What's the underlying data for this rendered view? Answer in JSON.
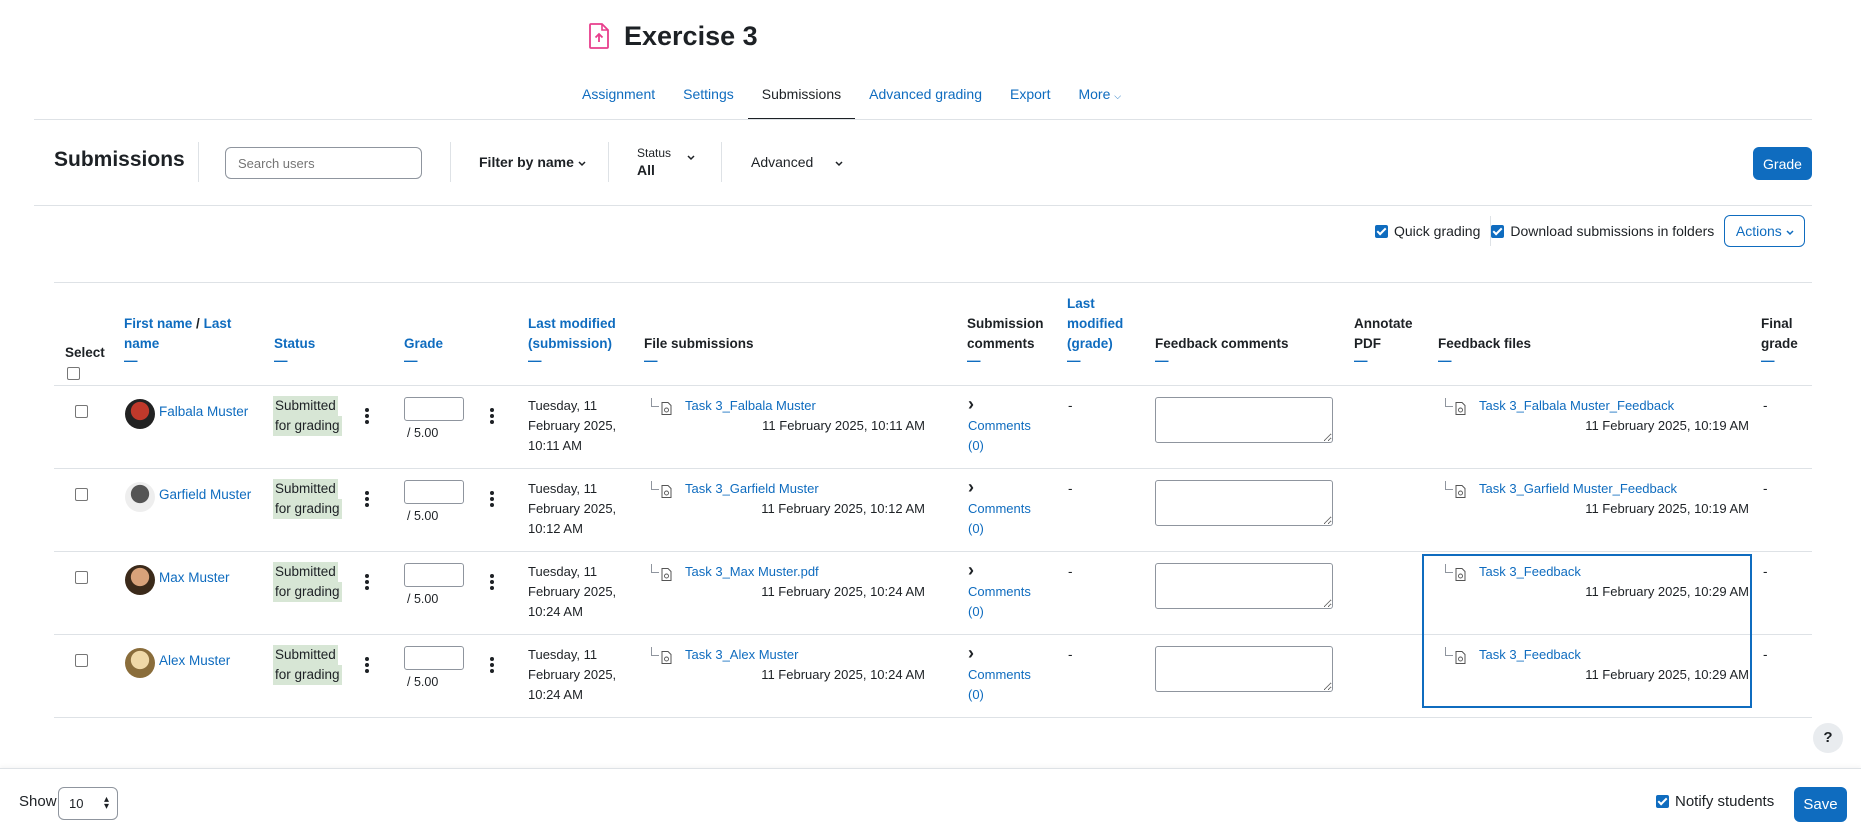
{
  "header": {
    "title": "Exercise 3"
  },
  "nav": {
    "tabs": [
      "Assignment",
      "Settings",
      "Submissions",
      "Advanced grading",
      "Export",
      "More"
    ]
  },
  "toolbar": {
    "title": "Submissions",
    "search_placeholder": "Search users",
    "filter_by_name": "Filter by name",
    "status_label": "Status",
    "status_value": "All",
    "advanced": "Advanced",
    "grade_button": "Grade"
  },
  "options": {
    "quick_grading": "Quick grading",
    "download_in_folders": "Download submissions in folders",
    "actions": "Actions"
  },
  "table": {
    "headers": {
      "select": "Select",
      "first_name": "First name",
      "slash": "/",
      "last_name": "Last name",
      "status": "Status",
      "grade": "Grade",
      "last_modified_sub_1": "Last modified",
      "last_modified_sub_2": "(submission)",
      "file_submissions": "File submissions",
      "submission_comments_1": "Submission",
      "submission_comments_2": "comments",
      "last_modified_grade_1": "Last",
      "last_modified_grade_2": "modified",
      "last_modified_grade_3": "(grade)",
      "feedback_comments": "Feedback comments",
      "annotate_pdf_1": "Annotate",
      "annotate_pdf_2": "PDF",
      "feedback_files": "Feedback files",
      "final_grade_1": "Final",
      "final_grade_2": "grade",
      "dash": "—"
    },
    "rows": [
      {
        "name": "Falbala Muster",
        "status_1": "Submitted",
        "status_2": "for grading",
        "grade_max": "/ 5.00",
        "modified_1": "Tuesday, 11",
        "modified_2": "February 2025,",
        "modified_3": "10:11 AM",
        "file_name": "Task 3_Falbala Muster",
        "file_date": "11 February 2025, 10:11 AM",
        "comments_1": "Comments",
        "comments_2": "(0)",
        "last_mod_grade": "-",
        "feedback_file": "Task 3_Falbala Muster_Feedback",
        "feedback_date": "11 February 2025, 10:19 AM",
        "final_grade": "-"
      },
      {
        "name": "Garfield Muster",
        "status_1": "Submitted",
        "status_2": "for grading",
        "grade_max": "/ 5.00",
        "modified_1": "Tuesday, 11",
        "modified_2": "February 2025,",
        "modified_3": "10:12 AM",
        "file_name": "Task 3_Garfield Muster",
        "file_date": "11 February 2025, 10:12 AM",
        "comments_1": "Comments",
        "comments_2": "(0)",
        "last_mod_grade": "-",
        "feedback_file": "Task 3_Garfield Muster_Feedback",
        "feedback_date": "11 February 2025, 10:19 AM",
        "final_grade": "-"
      },
      {
        "name": "Max Muster",
        "status_1": "Submitted",
        "status_2": "for grading",
        "grade_max": "/ 5.00",
        "modified_1": "Tuesday, 11",
        "modified_2": "February 2025,",
        "modified_3": "10:24 AM",
        "file_name": "Task 3_Max Muster.pdf",
        "file_date": "11 February 2025, 10:24 AM",
        "comments_1": "Comments",
        "comments_2": "(0)",
        "last_mod_grade": "-",
        "feedback_file": "Task 3_Feedback",
        "feedback_date": "11 February 2025, 10:29 AM",
        "final_grade": "-"
      },
      {
        "name": "Alex Muster",
        "status_1": "Submitted",
        "status_2": "for grading",
        "grade_max": "/ 5.00",
        "modified_1": "Tuesday, 11",
        "modified_2": "February 2025,",
        "modified_3": "10:24 AM",
        "file_name": "Task 3_Alex Muster",
        "file_date": "11 February 2025, 10:24 AM",
        "comments_1": "Comments",
        "comments_2": "(0)",
        "last_mod_grade": "-",
        "feedback_file": "Task 3_Feedback",
        "feedback_date": "11 February 2025, 10:29 AM",
        "final_grade": "-"
      }
    ]
  },
  "footer": {
    "show_label": "Show",
    "show_value": "10",
    "notify_students": "Notify students",
    "save": "Save",
    "help": "?"
  },
  "colors": {
    "link": "#0f6cbf",
    "badge_bg": "#d7e6d5",
    "accent_icon": "#e83e8c"
  }
}
